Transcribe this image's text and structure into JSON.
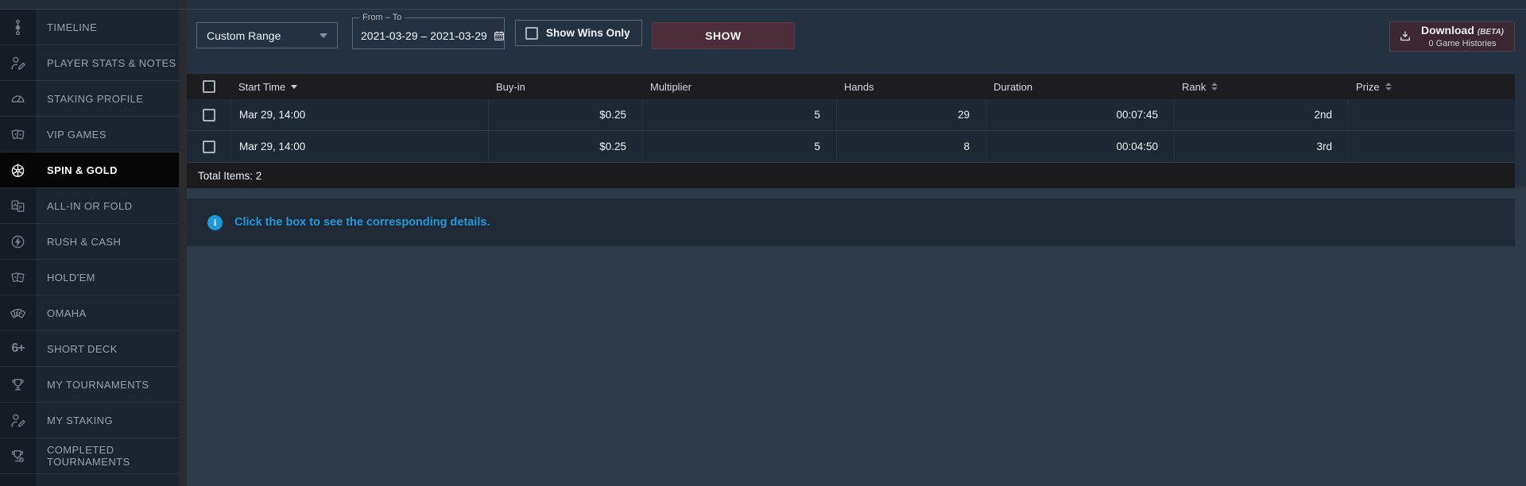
{
  "sidebar": {
    "items": [
      {
        "label": "TIMELINE",
        "icon": "timeline-icon",
        "active": false
      },
      {
        "label": "PLAYER STATS & NOTES",
        "icon": "player-stats-icon",
        "active": false
      },
      {
        "label": "STAKING PROFILE",
        "icon": "staking-profile-icon",
        "active": false
      },
      {
        "label": "VIP GAMES",
        "icon": "vip-games-icon",
        "active": false
      },
      {
        "label": "SPIN & GOLD",
        "icon": "spin-gold-icon",
        "active": true
      },
      {
        "label": "ALL-IN OR FOLD",
        "icon": "all-in-fold-icon",
        "active": false
      },
      {
        "label": "RUSH & CASH",
        "icon": "rush-cash-icon",
        "active": false
      },
      {
        "label": "HOLD'EM",
        "icon": "holdem-icon",
        "active": false
      },
      {
        "label": "OMAHA",
        "icon": "omaha-icon",
        "active": false
      },
      {
        "label": "SHORT DECK",
        "icon": "short-deck-icon",
        "active": false
      },
      {
        "label": "MY TOURNAMENTS",
        "icon": "tournaments-icon",
        "active": false
      },
      {
        "label": "MY STAKING",
        "icon": "my-staking-icon",
        "active": false
      },
      {
        "label": "COMPLETED TOURNAMENTS",
        "icon": "completed-tournaments-icon",
        "active": false
      }
    ]
  },
  "filters": {
    "range_select": {
      "value": "Custom Range",
      "icon": "chevron-down-icon"
    },
    "date_range": {
      "label": "From – To",
      "value": "2021-03-29 – 2021-03-29",
      "icon": "calendar-icon"
    },
    "show_wins_only": {
      "label": "Show Wins Only",
      "checked": false
    },
    "show_button_label": "SHOW",
    "download": {
      "label": "Download",
      "beta": "(BETA)",
      "sublabel": "0 Game Histories",
      "icon": "download-icon"
    }
  },
  "table": {
    "columns": [
      {
        "key": "select",
        "label": "",
        "type": "checkbox"
      },
      {
        "key": "start_time",
        "label": "Start Time",
        "sort": "desc",
        "align": "left"
      },
      {
        "key": "buy_in",
        "label": "Buy-in",
        "align": "right"
      },
      {
        "key": "multiplier",
        "label": "Multiplier",
        "align": "right"
      },
      {
        "key": "hands",
        "label": "Hands",
        "align": "right"
      },
      {
        "key": "duration",
        "label": "Duration",
        "align": "right"
      },
      {
        "key": "rank",
        "label": "Rank",
        "sort": "both",
        "align": "right"
      },
      {
        "key": "prize",
        "label": "Prize",
        "sort": "both",
        "align": "right"
      }
    ],
    "rows": [
      {
        "start_time": "Mar 29, 14:00",
        "buy_in": "$0.25",
        "multiplier": "5",
        "hands": "29",
        "duration": "00:07:45",
        "rank": "2nd",
        "prize": ""
      },
      {
        "start_time": "Mar 29, 14:00",
        "buy_in": "$0.25",
        "multiplier": "5",
        "hands": "8",
        "duration": "00:04:50",
        "rank": "3rd",
        "prize": ""
      }
    ],
    "total_label": "Total Items: 2"
  },
  "info": {
    "message": "Click the box to see the corresponding details.",
    "icon": "info-icon"
  },
  "colors": {
    "accent_blue": "#2596d6",
    "show_button_bg": "#4a2d39",
    "download_button_bg": "#3b2833",
    "active_sidebar_bg": "#050505",
    "table_header_bg": "#1d1d20",
    "row_bg": "#1d2834"
  }
}
